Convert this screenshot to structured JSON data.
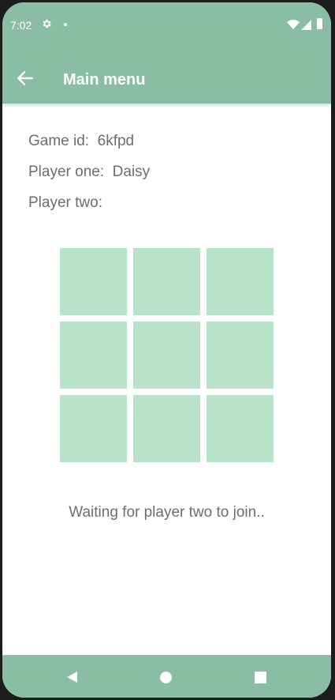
{
  "status_bar": {
    "time": "7:02",
    "icons": [
      "gear-icon",
      "notification-dot-icon",
      "wifi-icon",
      "cell-signal-icon",
      "battery-icon"
    ]
  },
  "app_bar": {
    "title": "Main menu",
    "back_icon": "arrow-left-icon"
  },
  "game_info": {
    "game_id_text": "Game id:  6kfpd",
    "player_one_text": "Player one:  Daisy",
    "player_two_text": "Player two: "
  },
  "board": {
    "cells": [
      "",
      "",
      "",
      "",
      "",
      "",
      "",
      "",
      ""
    ]
  },
  "message": "Waiting for player two to join..",
  "nav_bar": {
    "icons": [
      "nav-back-icon",
      "nav-home-icon",
      "nav-recents-icon"
    ]
  },
  "colors": {
    "accent": "#89bea4",
    "cell": "#b8e3c9",
    "text": "#6e6e6e"
  }
}
